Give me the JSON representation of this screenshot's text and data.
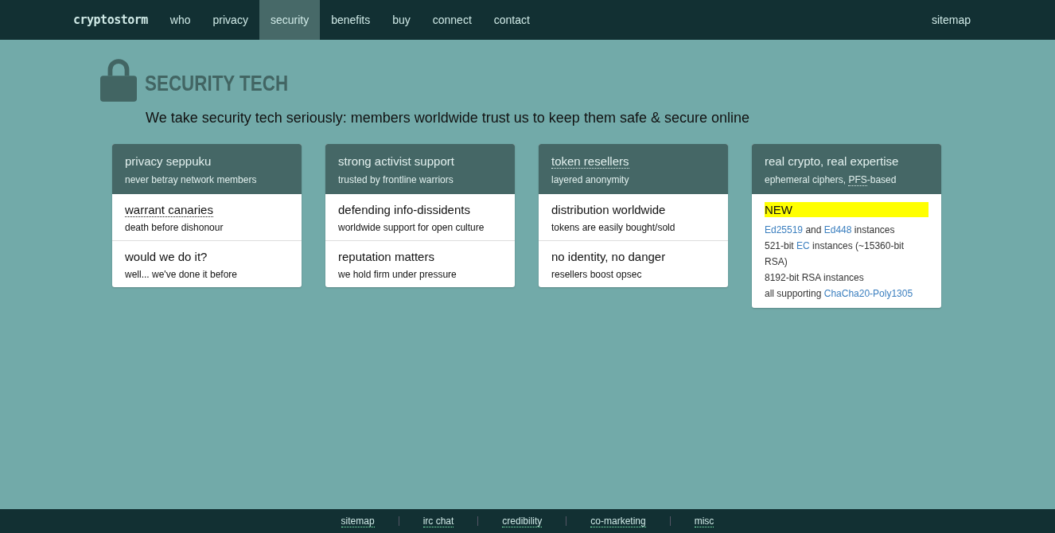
{
  "nav": {
    "logo": "cryptostorm",
    "items": [
      {
        "label": "who",
        "selected": false
      },
      {
        "label": "privacy",
        "selected": false
      },
      {
        "label": "security",
        "selected": true
      },
      {
        "label": "benefits",
        "selected": false
      },
      {
        "label": "buy",
        "selected": false
      },
      {
        "label": "connect",
        "selected": false
      },
      {
        "label": "contact",
        "selected": false
      }
    ],
    "right": "sitemap"
  },
  "heading": {
    "title": "SECURITY TECH",
    "tagline": "We take security tech seriously: members worldwide trust us to keep them safe & secure online"
  },
  "cards": [
    {
      "kind": "list",
      "title": "privacy seppuku",
      "title_dotted": false,
      "subtitle": [
        {
          "text": "never betray network members",
          "dotted": false
        }
      ],
      "items": [
        {
          "title": "warrant canaries",
          "dotted": true,
          "text": "death before dishonour"
        },
        {
          "title": "would we do it?",
          "dotted": false,
          "text": "well... we've done it before"
        }
      ]
    },
    {
      "kind": "list",
      "title": "strong activist support",
      "title_dotted": false,
      "subtitle": [
        {
          "text": "trusted by frontline warriors",
          "dotted": false
        }
      ],
      "items": [
        {
          "title": "defending info-dissidents",
          "dotted": false,
          "text": "worldwide support for open culture"
        },
        {
          "title": "reputation matters",
          "dotted": false,
          "text": "we hold firm under pressure"
        }
      ]
    },
    {
      "kind": "list",
      "title": "token resellers",
      "title_dotted": true,
      "subtitle": [
        {
          "text": "layered anonymity",
          "dotted": false
        }
      ],
      "items": [
        {
          "title": "distribution worldwide",
          "dotted": false,
          "text": "tokens are easily bought/sold"
        },
        {
          "title": "no identity, no danger",
          "dotted": false,
          "text": "resellers boost opsec"
        }
      ]
    },
    {
      "kind": "notes",
      "title": "real crypto, real expertise",
      "title_dotted": false,
      "subtitle": [
        {
          "text": "ephemeral ciphers, ",
          "dotted": false
        },
        {
          "text": "PFS",
          "dotted": true
        },
        {
          "text": "-based",
          "dotted": false
        }
      ],
      "badge": "NEW",
      "lines": [
        [
          {
            "text": "Ed25519",
            "link": true
          },
          {
            "text": " and ",
            "link": false
          },
          {
            "text": "Ed448",
            "link": true
          },
          {
            "text": " instances",
            "link": false
          }
        ],
        [
          {
            "text": "521-bit ",
            "link": false
          },
          {
            "text": "EC",
            "link": true
          },
          {
            "text": " instances (~15360-bit RSA)",
            "link": false
          }
        ],
        [
          {
            "text": "8192-bit RSA instances",
            "link": false
          }
        ],
        [
          {
            "text": "all supporting ",
            "link": false
          },
          {
            "text": "ChaCha20-Poly1305",
            "link": true
          }
        ]
      ]
    }
  ],
  "footer": [
    "sitemap",
    "irc chat",
    "credibility",
    "co-marketing",
    "misc"
  ]
}
